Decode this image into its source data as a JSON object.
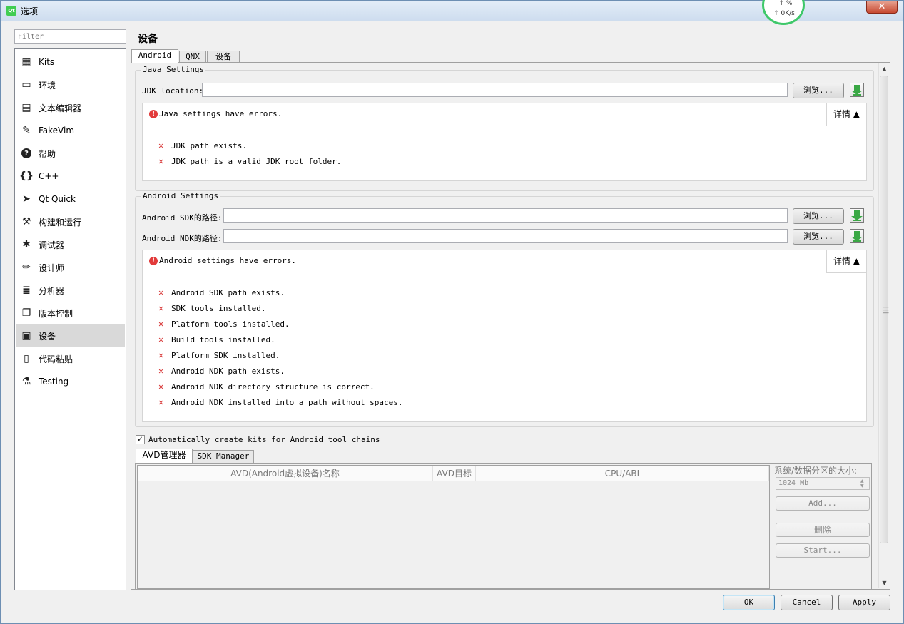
{
  "window": {
    "title": "选项",
    "app_icon": "Qt",
    "close_label": "✕"
  },
  "net_monitor": {
    "percent": "↑ %",
    "speed": "↑ 0K/s",
    "ring_color": "#3fc86a"
  },
  "filter": {
    "placeholder": "Filter"
  },
  "categories": [
    {
      "label": "Kits",
      "icon": "kits-icon"
    },
    {
      "label": "环境",
      "icon": "monitor-icon"
    },
    {
      "label": "文本编辑器",
      "icon": "text-editor-icon"
    },
    {
      "label": "FakeVim",
      "icon": "fakevim-icon"
    },
    {
      "label": "帮助",
      "icon": "help-icon"
    },
    {
      "label": "C++",
      "icon": "braces-icon"
    },
    {
      "label": "Qt Quick",
      "icon": "paper-plane-icon"
    },
    {
      "label": "构建和运行",
      "icon": "hammer-icon"
    },
    {
      "label": "调试器",
      "icon": "bug-icon"
    },
    {
      "label": "设计师",
      "icon": "pencil-icon"
    },
    {
      "label": "分析器",
      "icon": "analyzer-icon"
    },
    {
      "label": "版本控制",
      "icon": "version-control-icon"
    },
    {
      "label": "设备",
      "icon": "device-icon",
      "selected": true
    },
    {
      "label": "代码粘贴",
      "icon": "clipboard-icon"
    },
    {
      "label": "Testing",
      "icon": "flask-icon"
    }
  ],
  "page_title": "设备",
  "tabs": [
    "Android",
    "QNX",
    "设备"
  ],
  "java": {
    "group_title": "Java Settings",
    "jdk_label": "JDK location:",
    "jdk_value": "",
    "browse_label": "浏览...",
    "error_summary": "Java settings have errors.",
    "details_label": "详情 ▲",
    "checks": [
      "JDK path exists.",
      "JDK path is a valid JDK root folder."
    ]
  },
  "android": {
    "group_title": "Android Settings",
    "sdk_label": "Android SDK的路径:",
    "sdk_value": "",
    "ndk_label": "Android NDK的路径:",
    "ndk_value": "",
    "browse_label": "浏览...",
    "error_summary": "Android settings have errors.",
    "details_label": "详情 ▲",
    "checks": [
      "Android SDK path exists.",
      "SDK tools installed.",
      "Platform tools installed.",
      "Build tools installed.",
      "Platform SDK installed.",
      "Android NDK path exists.",
      "Android NDK directory structure is correct.",
      "Android NDK installed into a path without spaces."
    ]
  },
  "auto_kits": {
    "label": "Automatically create kits for Android tool chains",
    "checked": true,
    "mark": "✓"
  },
  "avd": {
    "tabs": [
      "AVD管理器",
      "SDK Manager"
    ],
    "columns": [
      "AVD(Android虚拟设备)名称",
      "AVD目标",
      "CPU/ABI"
    ],
    "partition_label": "系统/数据分区的大小:",
    "partition_value": "1024 Mb",
    "add_label": "Add...",
    "remove_label": "删除",
    "start_label": "Start..."
  },
  "footer": {
    "ok": "OK",
    "cancel": "Cancel",
    "apply": "Apply"
  }
}
